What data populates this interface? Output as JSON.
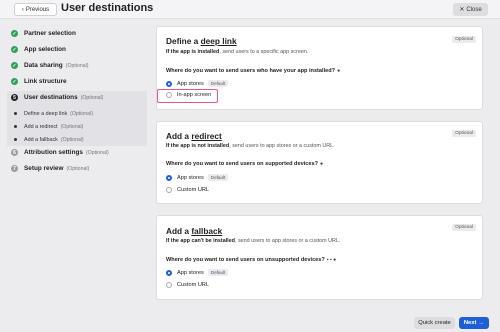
{
  "header": {
    "prev_label": "Previous",
    "prev_icon": "chevron-left-icon",
    "title": "User destinations",
    "close_label": "Close",
    "close_icon": "close-icon"
  },
  "sidebar": {
    "steps": [
      {
        "label": "Partner selection",
        "status": "done"
      },
      {
        "label": "App selection",
        "status": "done"
      },
      {
        "label": "Data sharing",
        "optional": "(Optional)",
        "status": "done"
      },
      {
        "label": "Link structure",
        "status": "done"
      },
      {
        "label": "User destinations",
        "optional": "(Optional)",
        "number": "5",
        "status": "active"
      },
      {
        "label": "Attribution settings",
        "optional": "(Optional)",
        "number": "6",
        "status": "todo"
      },
      {
        "label": "Setup review",
        "optional": "(Optional)",
        "number": "7",
        "status": "todo"
      }
    ],
    "substeps": [
      {
        "label": "Define a deep link",
        "optional": "(Optional)"
      },
      {
        "label": "Add a redirect",
        "optional": "(Optional)"
      },
      {
        "label": "Add a fallback",
        "optional": "(Optional)"
      }
    ],
    "check_icon": "✓"
  },
  "cards": {
    "deeplink": {
      "title_prefix": "Define a ",
      "title_link": "deep link",
      "desc_bold": "If the app is installed",
      "desc_rest": ", send users to a specific app screen.",
      "badge": "Optional",
      "question": "Where do you want to send users who have your app installed?",
      "options": [
        {
          "label": "App stores",
          "tag": "Default",
          "selected": true
        },
        {
          "label": "In-app screen",
          "selected": false
        }
      ]
    },
    "redirect": {
      "title_prefix": "Add a ",
      "title_link": "redirect",
      "desc_bold": "If the app is not installed",
      "desc_rest": ", send users to app stores or a custom URL.",
      "badge": "Optional",
      "question": "Where do you want to send users on supported devices?",
      "options": [
        {
          "label": "App stores",
          "tag": "Default",
          "selected": true
        },
        {
          "label": "Custom URL",
          "selected": false
        }
      ]
    },
    "fallback": {
      "title_prefix": "Add a ",
      "title_link": "fallback",
      "desc_bold": "If the app can't be installed",
      "desc_rest": ", send users to app stores or a custom URL.",
      "badge": "Optional",
      "question": "Where do you want to send users on unsupported devices?",
      "options": [
        {
          "label": "App stores",
          "tag": "Default",
          "selected": true
        },
        {
          "label": "Custom URL",
          "selected": false
        }
      ]
    }
  },
  "footer": {
    "quick_create_label": "Quick create",
    "next_label": "Next",
    "next_icon": "arrow-right-icon"
  },
  "colors": {
    "primary": "#1f5fd6",
    "done": "#2f9e5a",
    "highlight": "#e0579a"
  }
}
